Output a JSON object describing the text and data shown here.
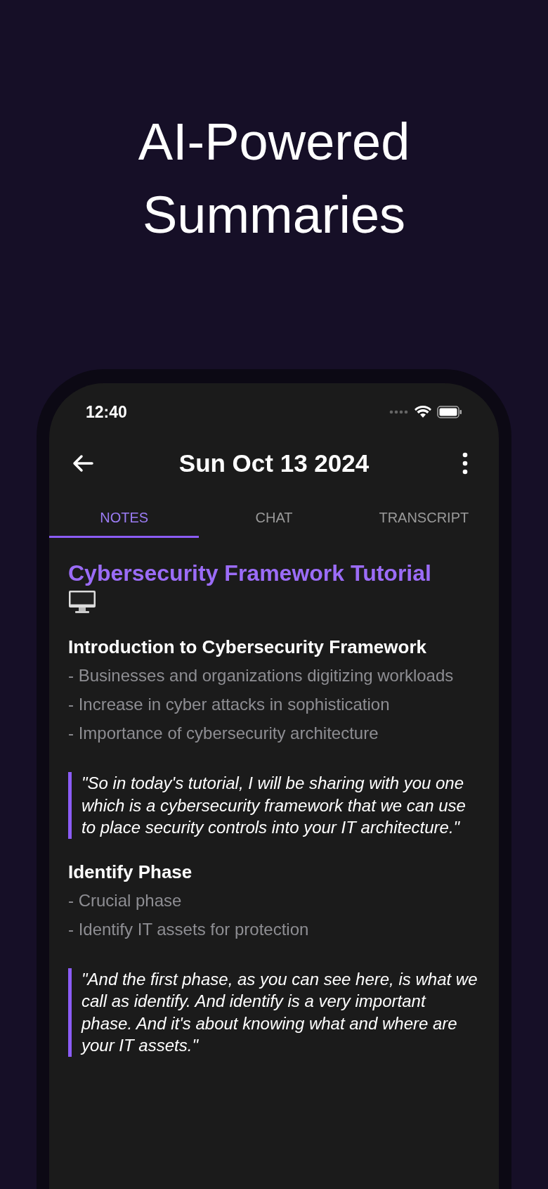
{
  "heading_lines": [
    "AI-Powered",
    "Summaries"
  ],
  "status_bar": {
    "time": "12:40"
  },
  "header": {
    "title": "Sun Oct 13 2024"
  },
  "tabs": [
    {
      "label": "NOTES",
      "selected": true
    },
    {
      "label": "CHAT",
      "selected": false
    },
    {
      "label": "TRANSCRIPT",
      "selected": false
    }
  ],
  "note": {
    "title": "Cybersecurity Framework Tutorial",
    "blocks": [
      {
        "kind": "heading",
        "text": "Introduction to Cybersecurity Framework"
      },
      {
        "kind": "bullets",
        "items": [
          "- Businesses and organizations digitizing workloads",
          "- Increase in cyber attacks in sophistication",
          "- Importance of cybersecurity architecture"
        ]
      },
      {
        "kind": "quote",
        "text": "\"So in today's tutorial, I will be sharing with you one which is a cybersecurity framework that we can use to place security controls into your IT architecture.\""
      },
      {
        "kind": "heading",
        "text": "Identify Phase"
      },
      {
        "kind": "bullets",
        "items": [
          "- Crucial phase",
          "- Identify IT assets for protection"
        ]
      },
      {
        "kind": "quote",
        "text": "\"And the first phase, as you can see here, is what we call as identify. And identify is a very important phase. And it's about knowing what and where are your IT assets.\""
      }
    ]
  }
}
